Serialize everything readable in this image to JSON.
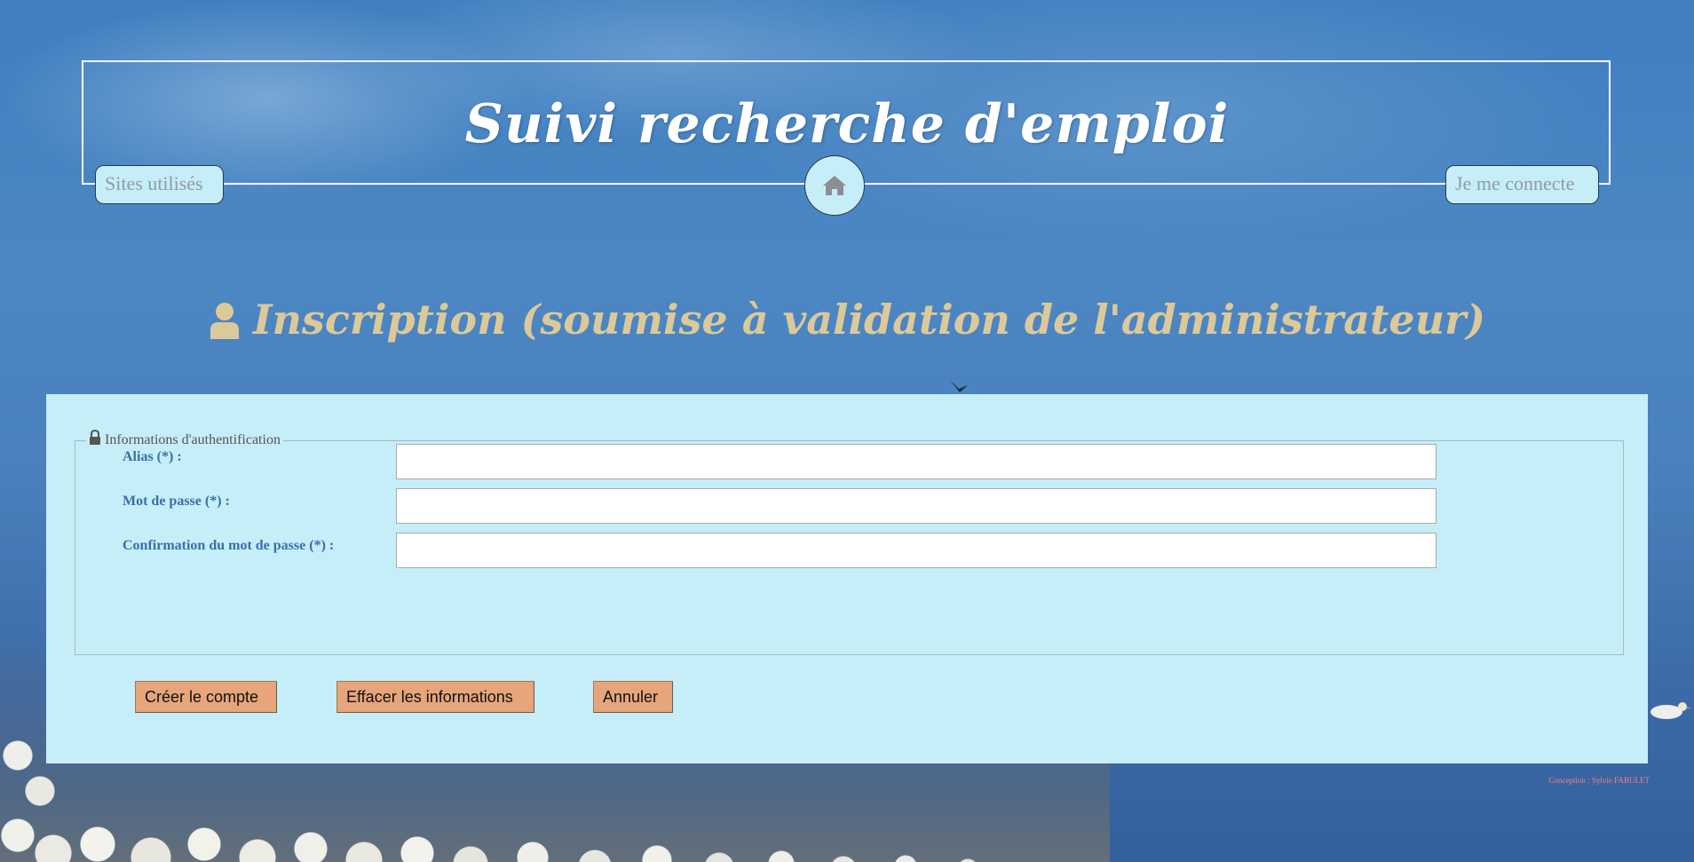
{
  "header": {
    "title": "Suivi recherche d'emploi",
    "nav_left": "Sites utilisés",
    "nav_right": "Je me connecte",
    "home_icon": "home-icon"
  },
  "page": {
    "heading": "Inscription (soumise à validation de l'administrateur)",
    "heading_icon": "user-icon",
    "heading_color": "#dcc99a"
  },
  "form": {
    "legend": "Informations d'authentification",
    "legend_icon": "lock-icon",
    "fields": [
      {
        "label": "Alias (*) :",
        "value": "",
        "placeholder": ""
      },
      {
        "label": "Mot de passe (*) :",
        "value": "",
        "placeholder": ""
      },
      {
        "label": "Confirmation du mot de passe (*) :",
        "value": "",
        "placeholder": ""
      }
    ],
    "buttons": {
      "create": "Créer le compte",
      "clear": "Effacer les informations",
      "cancel": "Annuler"
    }
  },
  "footer": {
    "credit": "Conception : Sylvie FABULET"
  },
  "colors": {
    "panel_bg": "#c6eef8",
    "button_bg": "#e6a57a",
    "label_color": "#3a6fa8",
    "credit_color": "#ff7a7a"
  }
}
